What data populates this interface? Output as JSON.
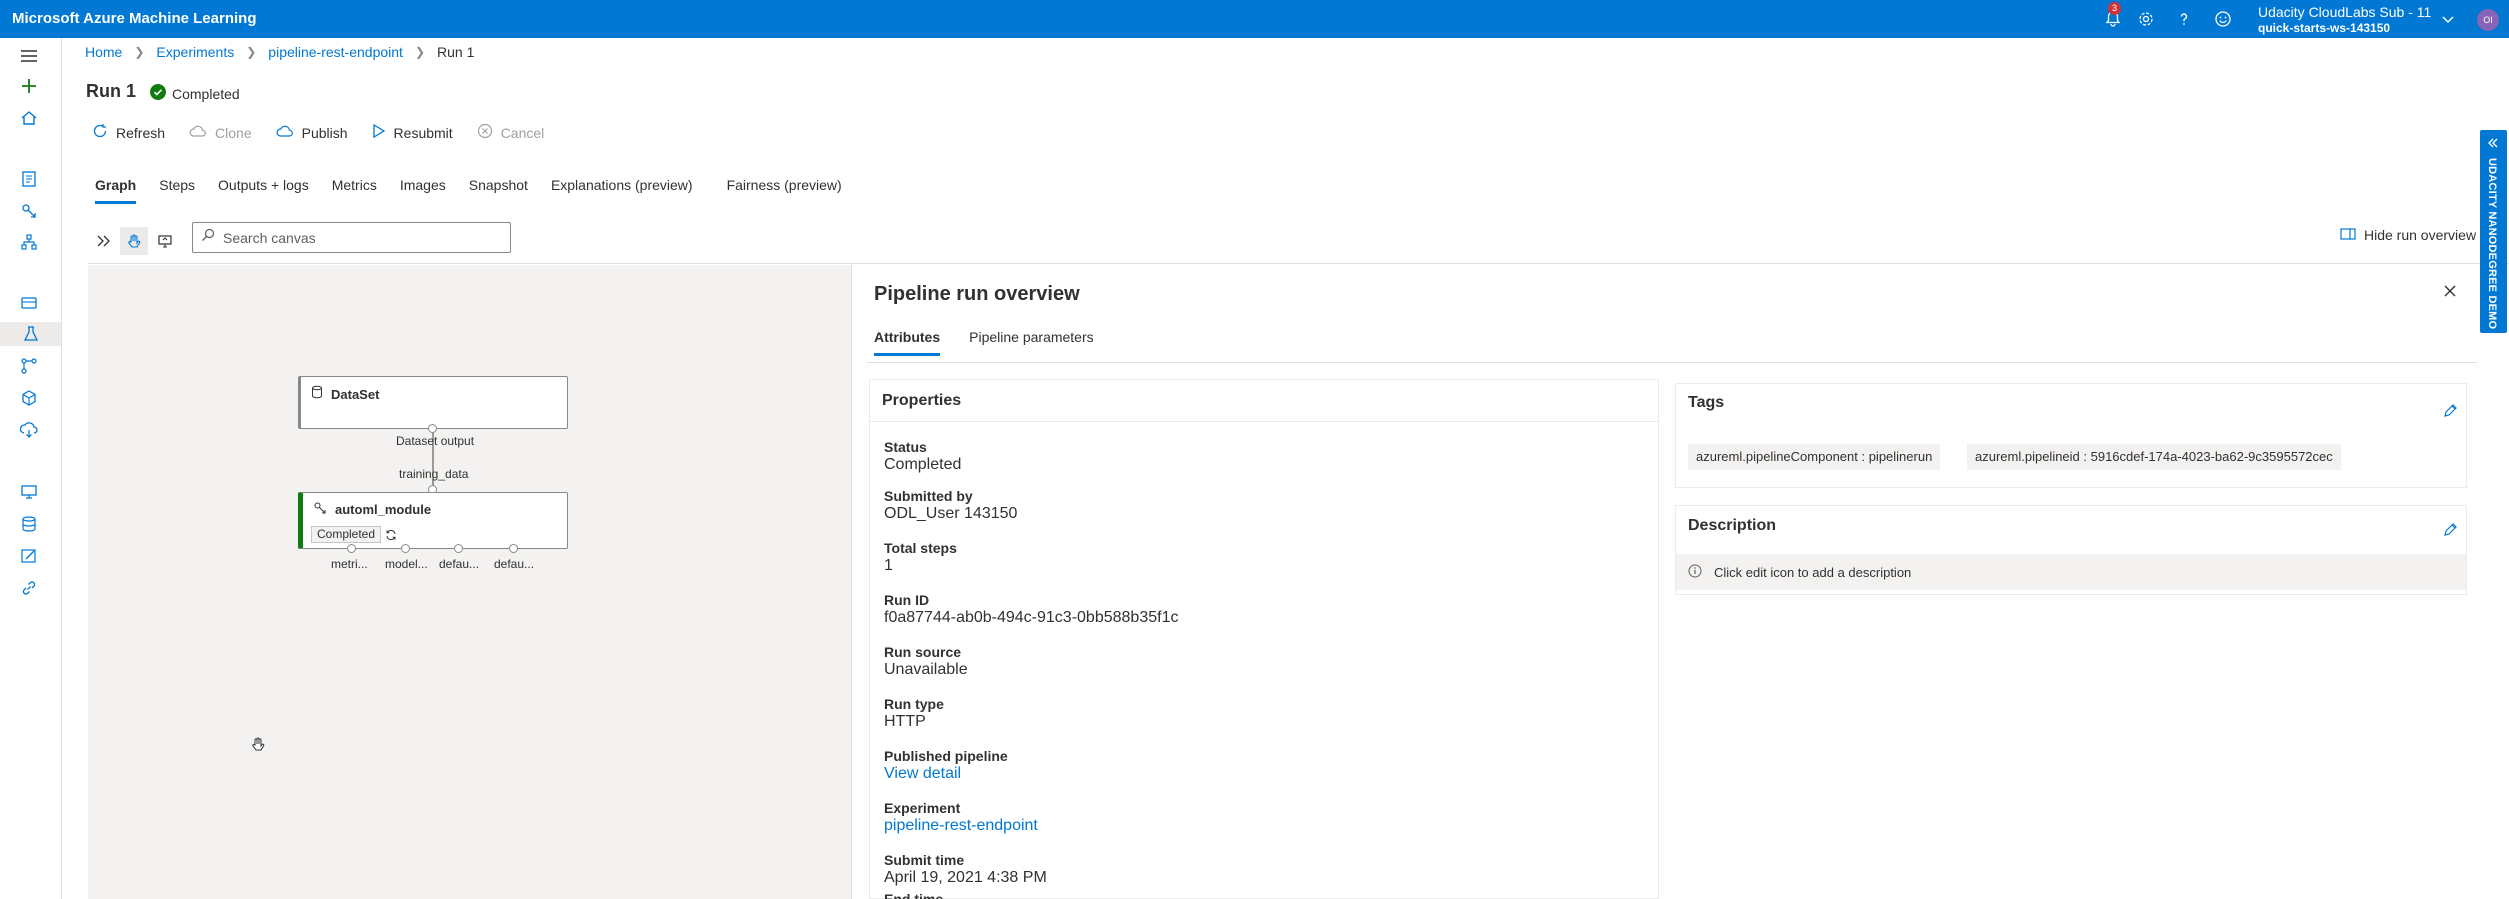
{
  "app": {
    "title": "Microsoft Azure Machine Learning",
    "notifications_count": "3",
    "account_name": "Udacity CloudLabs Sub - 11",
    "workspace": "quick-starts-ws-143150",
    "avatar_initials": "OI"
  },
  "breadcrumb": [
    "Home",
    "Experiments",
    "pipeline-rest-endpoint",
    "Run 1"
  ],
  "run": {
    "title": "Run 1",
    "status": "Completed"
  },
  "toolbar": {
    "refresh": "Refresh",
    "clone": "Clone",
    "publish": "Publish",
    "resubmit": "Resubmit",
    "cancel": "Cancel"
  },
  "tabs": [
    "Graph",
    "Steps",
    "Outputs + logs",
    "Metrics",
    "Images",
    "Snapshot",
    "Explanations (preview)",
    "Fairness (preview)"
  ],
  "canvas_toolbar": {
    "search_placeholder": "Search canvas",
    "hide_overview": "Hide run overview"
  },
  "graph": {
    "dataset_node": "DataSet",
    "dataset_output": "Dataset output",
    "edge_label": "training_data",
    "module_node": "automl_module",
    "module_status": "Completed",
    "output_ports": [
      "metri...",
      "model...",
      "defau...",
      "defau..."
    ]
  },
  "overview": {
    "title": "Pipeline run overview",
    "tabs": [
      "Attributes",
      "Pipeline parameters"
    ],
    "properties_heading": "Properties",
    "properties": [
      {
        "label": "Status",
        "value": "Completed"
      },
      {
        "label": "Submitted by",
        "value": "ODL_User 143150"
      },
      {
        "label": "Total steps",
        "value": "1"
      },
      {
        "label": "Run ID",
        "value": "f0a87744-ab0b-494c-91c3-0bb588b35f1c"
      },
      {
        "label": "Run source",
        "value": "Unavailable"
      },
      {
        "label": "Run type",
        "value": "HTTP"
      },
      {
        "label": "Published pipeline",
        "value": "View detail"
      },
      {
        "label": "Experiment",
        "value": "pipeline-rest-endpoint"
      },
      {
        "label": "Submit time",
        "value": "April 19, 2021 4:38 PM"
      },
      {
        "label": "End time",
        "value": ""
      }
    ],
    "tags_heading": "Tags",
    "tags": [
      "azureml.pipelineComponent : pipelinerun",
      "azureml.pipelineid : 5916cdef-174a-4023-ba62-9c3595572cec"
    ],
    "description_heading": "Description",
    "description_hint": "Click edit icon to add a description"
  },
  "side_banner": "UDACITY NANODEGREE DEMO",
  "colors": {
    "brand": "#0078d4",
    "success": "#107c10",
    "link": "#0078d4"
  }
}
